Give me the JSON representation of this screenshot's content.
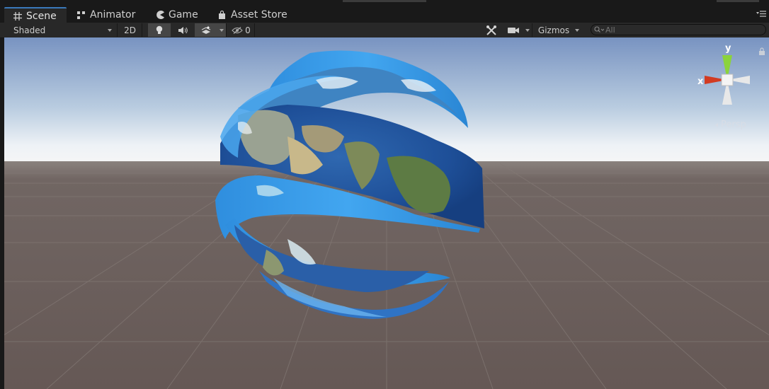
{
  "tabs": [
    {
      "id": "scene",
      "label": "Scene",
      "icon": "hash-icon",
      "active": true
    },
    {
      "id": "animator",
      "label": "Animator",
      "icon": "animator-icon",
      "active": false
    },
    {
      "id": "game",
      "label": "Game",
      "icon": "pacman-icon",
      "active": false
    },
    {
      "id": "asset-store",
      "label": "Asset Store",
      "icon": "shopping-bag-icon",
      "active": false
    }
  ],
  "toolbar": {
    "shading_mode": "Shaded",
    "mode_2d": "2D",
    "lighting_icon": "lightbulb-icon",
    "audio_icon": "speaker-icon",
    "effects_icon": "effects-icon",
    "hidden_count": "0",
    "tools_icon": "wrench-icon",
    "camera_icon": "camera-icon",
    "gizmos_label": "Gizmos",
    "search_placeholder": "All"
  },
  "viewport": {
    "projection_label": "Persp",
    "gizmo_axes": {
      "x": "x",
      "y": "y"
    }
  },
  "colors": {
    "accent": "#3a79bb",
    "sky_top": "#7e9bc8",
    "ground": "#6a5d59",
    "axis_x": "#d23b22",
    "axis_y": "#8bd33b"
  }
}
